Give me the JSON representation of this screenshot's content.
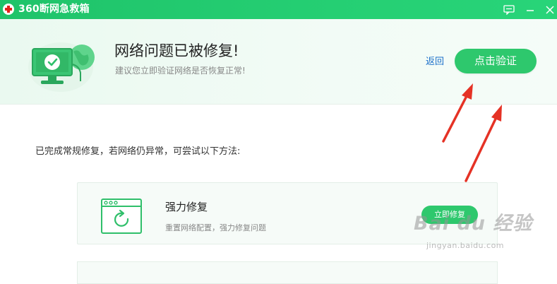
{
  "window": {
    "title": "360断网急救箱",
    "controls": [
      "feedback-icon",
      "minimize-icon",
      "close-icon"
    ]
  },
  "result": {
    "title": "网络问题已被修复!",
    "subtitle": "建议您立即验证网络是否恢复正常!",
    "back_label": "返回",
    "verify_label": "点击验证"
  },
  "hint": "已完成常规修复，若网络仍异常，可尝试以下方法:",
  "methods": [
    {
      "title": "强力修复",
      "description": "重置网络配置，强力修复问题",
      "button_label": "立即修复",
      "icon": "browser-refresh-icon"
    }
  ],
  "watermark": {
    "brand": "Bai du 经验",
    "url": "jingyan.baidu.com"
  },
  "colors": {
    "titlebar_green": "#25cf73",
    "button_green": "#2ec86d",
    "link_blue": "#1a6fc9",
    "annotation_red": "#e53225",
    "panel_bg": "#eef9f2"
  }
}
